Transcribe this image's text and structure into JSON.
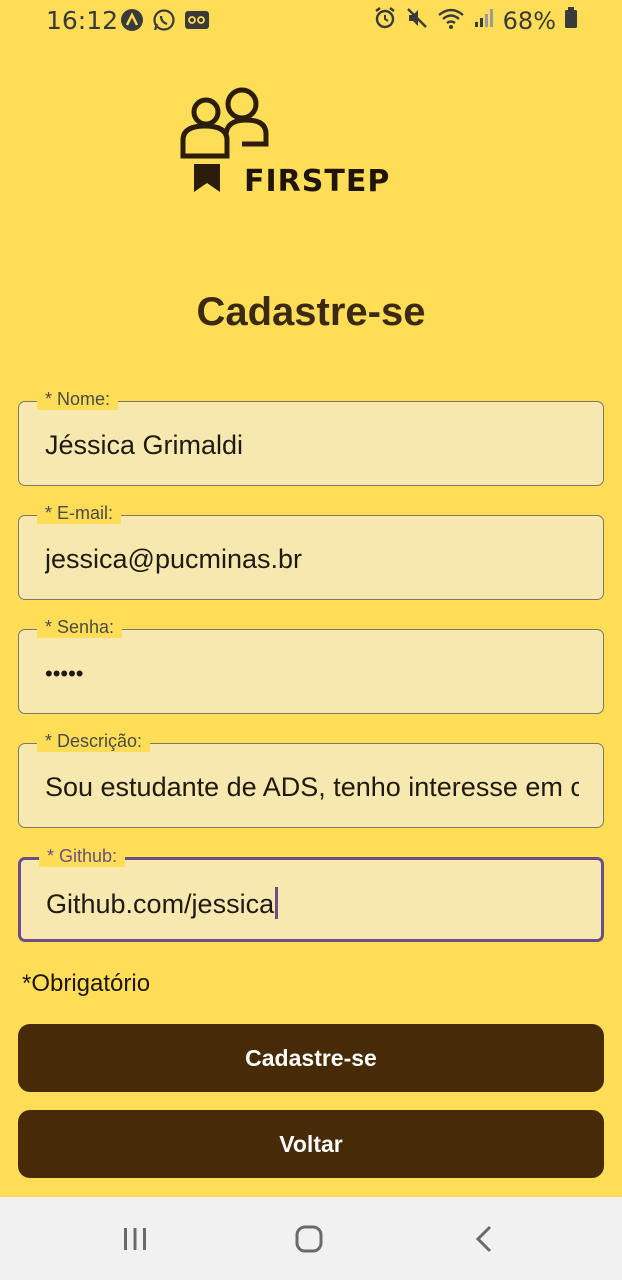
{
  "status_bar": {
    "time": "16:12",
    "left_icons": [
      "app-icon",
      "whatsapp-icon",
      "voicemail-icon"
    ],
    "right_icons": [
      "alarm-icon",
      "mute-icon",
      "wifi-icon",
      "signal-icon",
      "battery-icon"
    ],
    "battery": "68%"
  },
  "logo": {
    "text": "FIRSTEP"
  },
  "page": {
    "title": "Cadastre-se"
  },
  "form": {
    "name": {
      "label": "* Nome:",
      "value": "Jéssica Grimaldi"
    },
    "email": {
      "label": "* E-mail:",
      "value": "jessica@pucminas.br"
    },
    "password": {
      "label": "* Senha:",
      "value": "•••••"
    },
    "description": {
      "label": "* Descrição:",
      "value": "Sou estudante de ADS, tenho interesse em c"
    },
    "github": {
      "label": "* Github:",
      "value": "Github.com/jessica"
    },
    "required_note": "*Obrigatório"
  },
  "buttons": {
    "register": "Cadastre-se",
    "back": "Voltar"
  },
  "colors": {
    "background": "#FFDD57",
    "field_bg": "#F7E8B0",
    "button_bg": "#472A06",
    "focus": "#6b4f86",
    "nav_bg": "#F2F1F1"
  }
}
